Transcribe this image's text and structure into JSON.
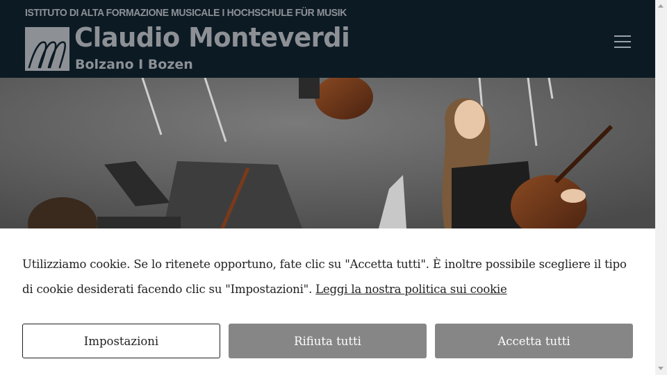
{
  "header": {
    "tagline": "ISTITUTO DI ALTA FORMAZIONE MUSICALE I HOCHSCHULE FÜR MUSIK",
    "brand_name": "Claudio Monteverdi",
    "brand_city": "Bolzano I Bozen",
    "menu_icon": "hamburger-menu-icon"
  },
  "hero": {
    "image": "photo-of-musicians-with-cello-and-double-bass"
  },
  "cookie_banner": {
    "message": "Utilizziamo cookie. Se lo ritenete opportuno, fate clic su \"Accetta tutti\". È inoltre possibile scegliere il tipo di cookie desiderati facendo clic su \"Impostazioni\".",
    "policy_link": "Leggi la nostra politica sui cookie",
    "buttons": {
      "settings": "Impostazioni",
      "reject": "Rifiuta tutti",
      "accept": "Accetta tutti"
    }
  },
  "colors": {
    "header_bg": "#0c1a24",
    "logo_gray": "#8d9196",
    "button_gray": "#868686",
    "text": "#222222"
  }
}
